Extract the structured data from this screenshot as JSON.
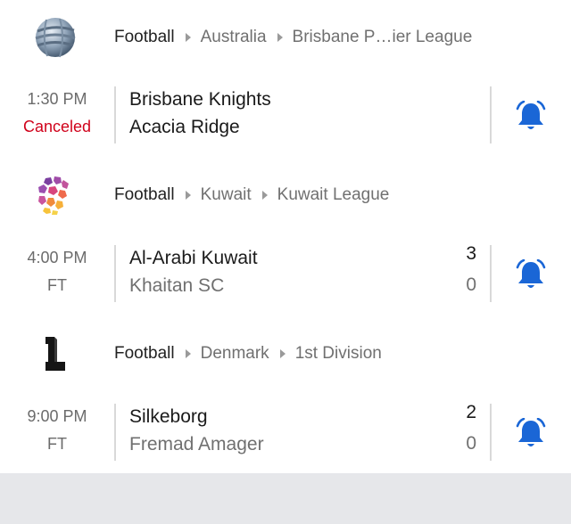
{
  "leagues": [
    {
      "sport": "Football",
      "country": "Australia",
      "league": "Brisbane P…ier League",
      "logo_icon": "globe-logo-icon",
      "match": {
        "time": "1:30 PM",
        "status": "Canceled",
        "home": "Brisbane Knights",
        "away": "Acacia Ridge",
        "home_score": "",
        "away_score": ""
      }
    },
    {
      "sport": "Football",
      "country": "Kuwait",
      "league": "Kuwait League",
      "logo_icon": "hexagon-ball-logo-icon",
      "match": {
        "time": "4:00 PM",
        "status": "FT",
        "home": "Al-Arabi Kuwait",
        "away": "Khaitan SC",
        "home_score": "3",
        "away_score": "0"
      }
    },
    {
      "sport": "Football",
      "country": "Denmark",
      "league": "1st Division",
      "logo_icon": "numeral-one-logo-icon",
      "match": {
        "time": "9:00 PM",
        "status": "FT",
        "home": "Silkeborg",
        "away": "Fremad Amager",
        "home_score": "2",
        "away_score": "0"
      }
    }
  ],
  "colors": {
    "bell_blue": "#1a66d6",
    "canceled_red": "#d0021b"
  }
}
